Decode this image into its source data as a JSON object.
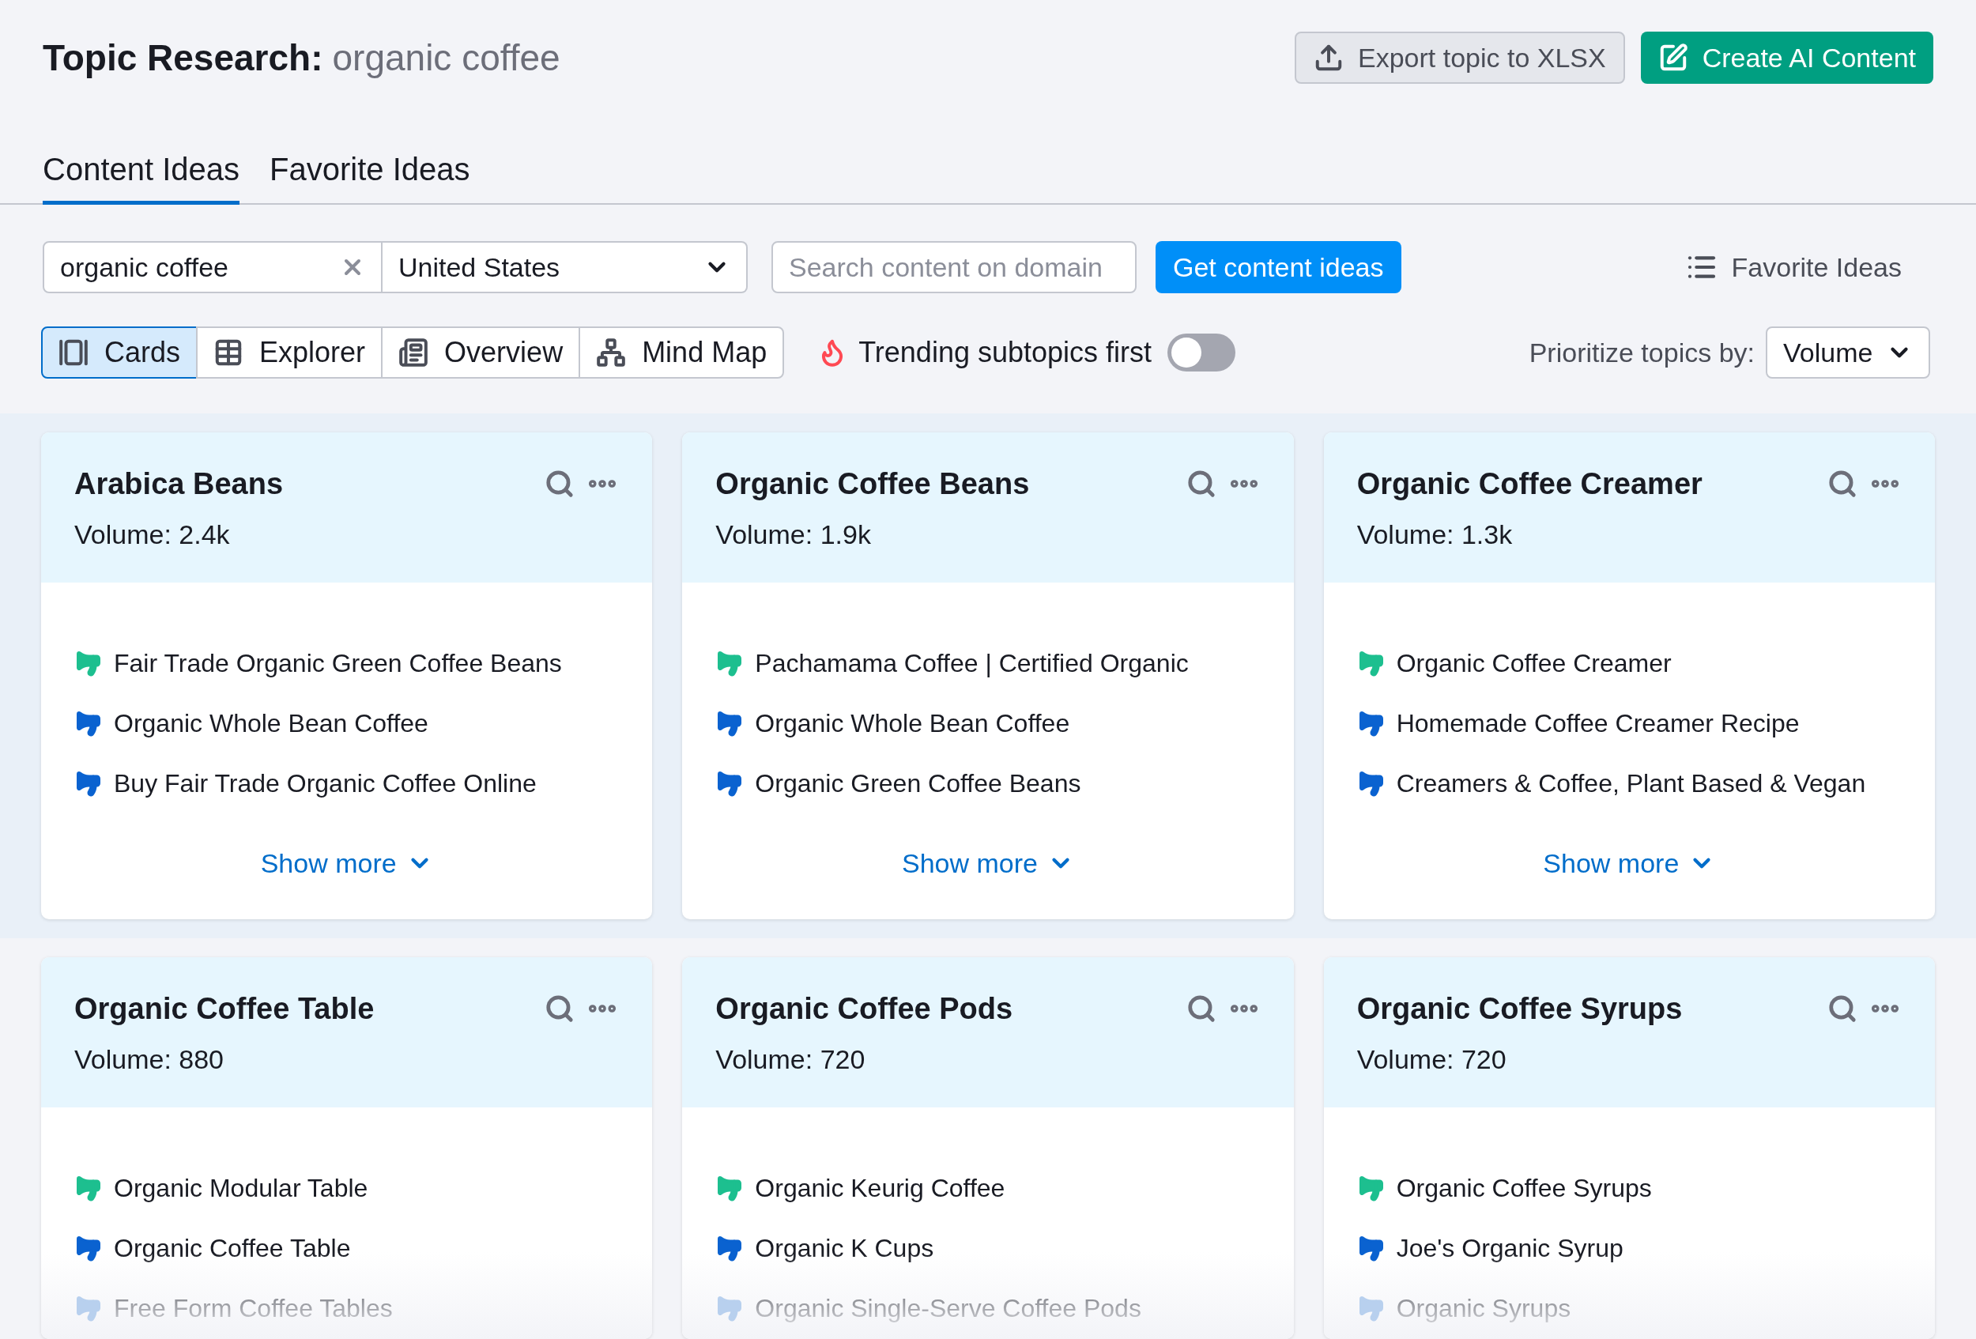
{
  "header": {
    "title": "Topic Research:",
    "topic": "organic coffee",
    "buttons": [
      {
        "kind": "secondary",
        "label": "Export topic to XLSX"
      },
      {
        "kind": "primary",
        "label": "Create AI Content"
      }
    ]
  },
  "tabs": [
    {
      "label": "Content Ideas",
      "selected": true
    },
    {
      "label": "Favorite Ideas",
      "selected": false
    }
  ],
  "search": {
    "value": "organic coffee",
    "country": "United States",
    "domain_placeholder": "Search content on domain",
    "submit": "Get content ideas",
    "favorites_link": "Favorite Ideas"
  },
  "views": [
    {
      "label": "Cards",
      "selected": true
    },
    {
      "label": "Explorer",
      "selected": false
    },
    {
      "label": "Overview",
      "selected": false
    },
    {
      "label": "Mind Map",
      "selected": false
    }
  ],
  "trending": {
    "label": "Trending subtopics first",
    "on": false
  },
  "prioritize": {
    "label": "Prioritize topics by:",
    "value": "Volume"
  },
  "card_rows": [
    {
      "cards": [
        {
          "title": "Arabica Beans",
          "volume": "Volume: 2.4k",
          "ideas": [
            {
              "text": "Fair Trade Organic Green Coffee Beans",
              "color": "#1dbf8f"
            },
            {
              "text": "Organic Whole Bean Coffee",
              "color": "#0a62d0"
            },
            {
              "text": "Buy Fair Trade Organic Coffee Online",
              "color": "#0a62d0"
            }
          ],
          "show_more": "Show more"
        },
        {
          "title": "Organic Coffee Beans",
          "volume": "Volume: 1.9k",
          "ideas": [
            {
              "text": "Pachamama Coffee | Certified Organic",
              "color": "#1dbf8f"
            },
            {
              "text": "Organic Whole Bean Coffee",
              "color": "#0a62d0"
            },
            {
              "text": "Organic Green Coffee Beans",
              "color": "#0a62d0"
            }
          ],
          "show_more": "Show more"
        },
        {
          "title": "Organic Coffee Creamer",
          "volume": "Volume: 1.3k",
          "ideas": [
            {
              "text": "Organic Coffee Creamer",
              "color": "#1dbf8f"
            },
            {
              "text": "Homemade Coffee Creamer Recipe",
              "color": "#0a62d0"
            },
            {
              "text": "Creamers & Coffee, Plant Based & Vegan",
              "color": "#0a62d0"
            }
          ],
          "show_more": "Show more"
        }
      ]
    },
    {
      "cards": [
        {
          "title": "Organic Coffee Table",
          "volume": "Volume: 880",
          "ideas": [
            {
              "text": "Organic Modular Table",
              "color": "#1dbf8f"
            },
            {
              "text": "Organic Coffee Table",
              "color": "#0a62d0"
            },
            {
              "text": "Free Form Coffee Tables",
              "color": "#b8d0ee"
            }
          ]
        },
        {
          "title": "Organic Coffee Pods",
          "volume": "Volume: 720",
          "ideas": [
            {
              "text": "Organic Keurig Coffee",
              "color": "#1dbf8f"
            },
            {
              "text": "Organic K Cups",
              "color": "#0a62d0"
            },
            {
              "text": "Organic Single-Serve Coffee Pods",
              "color": "#b8d0ee"
            }
          ]
        },
        {
          "title": "Organic Coffee Syrups",
          "volume": "Volume: 720",
          "ideas": [
            {
              "text": "Organic Coffee Syrups",
              "color": "#1dbf8f"
            },
            {
              "text": "Joe's Organic Syrup",
              "color": "#0a62d0"
            },
            {
              "text": "Organic Syrups",
              "color": "#b8d0ee"
            }
          ]
        }
      ]
    }
  ]
}
